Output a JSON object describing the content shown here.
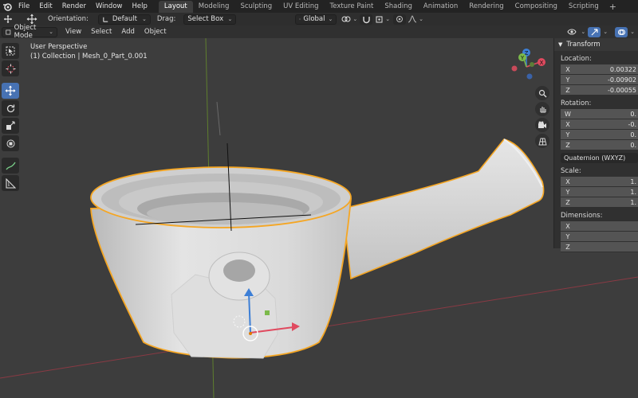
{
  "menubar": {
    "items": [
      "File",
      "Edit",
      "Render",
      "Window",
      "Help"
    ],
    "workspaces": [
      "Layout",
      "Modeling",
      "Sculpting",
      "UV Editing",
      "Texture Paint",
      "Shading",
      "Animation",
      "Rendering",
      "Compositing",
      "Scripting"
    ],
    "active_workspace": "Layout",
    "add_tab": "+"
  },
  "toolheader": {
    "orientation_label": "Orientation:",
    "orientation_value": "Default",
    "drag_label": "Drag:",
    "drag_value": "Select Box",
    "transform_orientation": "Global"
  },
  "viewport_header": {
    "mode": "Object Mode",
    "menus": [
      "View",
      "Select",
      "Add",
      "Object"
    ]
  },
  "viewport": {
    "perspective": "User Perspective",
    "collection": "(1) Collection | Mesh_0_Part_0.001"
  },
  "gizmo": {
    "x": "X",
    "y": "Y",
    "z": "Z"
  },
  "npanel": {
    "title": "Transform",
    "location_label": "Location:",
    "location": [
      {
        "axis": "X",
        "value": "0.00322"
      },
      {
        "axis": "Y",
        "value": "-0.00902"
      },
      {
        "axis": "Z",
        "value": "-0.00055"
      }
    ],
    "rotation_label": "Rotation:",
    "rotation": [
      {
        "axis": "W",
        "value": "0."
      },
      {
        "axis": "X",
        "value": "-0."
      },
      {
        "axis": "Y",
        "value": "0."
      },
      {
        "axis": "Z",
        "value": "0."
      }
    ],
    "rotation_mode": "Quaternion (WXYZ)",
    "scale_label": "Scale:",
    "scale": [
      {
        "axis": "X",
        "value": "1."
      },
      {
        "axis": "Y",
        "value": "1."
      },
      {
        "axis": "Z",
        "value": "1."
      }
    ],
    "dimensions_label": "Dimensions:",
    "dimensions": [
      {
        "axis": "X",
        "value": ""
      },
      {
        "axis": "Y",
        "value": ""
      },
      {
        "axis": "Z",
        "value": ""
      }
    ]
  },
  "colors": {
    "accent": "#4772b3",
    "selection_outline": "#f5a623",
    "axis_x": "#c94a5a",
    "axis_y": "#7a9a3a",
    "axis_z": "#3d7fd6"
  }
}
